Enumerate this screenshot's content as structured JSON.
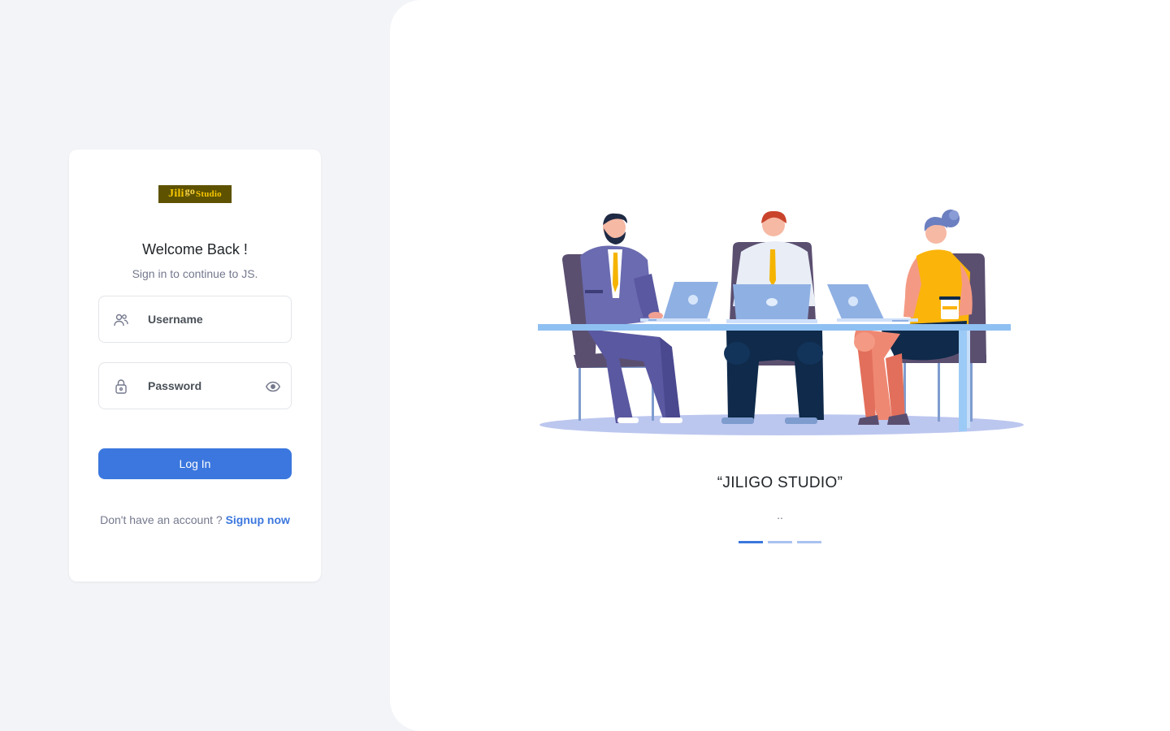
{
  "brand": {
    "logo_part1": "Jili",
    "logo_part2": "go",
    "logo_part3": "Studio",
    "logo_bg": "#5e5200",
    "logo_fg": "#f7c600"
  },
  "login": {
    "title": "Welcome Back !",
    "subtitle": "Sign in to continue to JS.",
    "username_placeholder": "Username",
    "password_placeholder": "Password",
    "login_button": "Log In",
    "signup_prompt": "Don't have an account ? ",
    "signup_link": "Signup now"
  },
  "carousel": {
    "title": "“JILIGO STUDIO”",
    "text": "..",
    "slides_total": 3,
    "active_slide": 1
  },
  "icons": {
    "username": "users-icon",
    "password": "lock-icon",
    "toggle_password": "eye-icon"
  },
  "colors": {
    "accent": "#3b77de",
    "page_bg": "#f2f4f7",
    "card_bg": "#ffffff",
    "muted_text": "#74788d"
  }
}
